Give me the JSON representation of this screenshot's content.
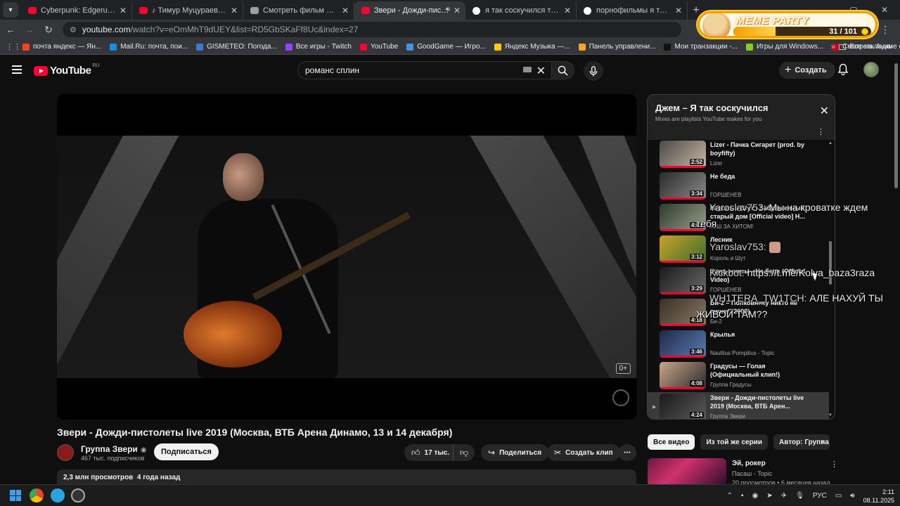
{
  "browser": {
    "tabs": [
      {
        "title": "Cyberpunk: Edgerunners | \"I Re",
        "icon": "youtube-icon",
        "active": false
      },
      {
        "title": "♪ Тимур Муцураев - Погасли",
        "icon": "youtube-icon",
        "active": false
      },
      {
        "title": "Смотреть фильм Война онлай",
        "icon": "page-icon",
        "active": false
      },
      {
        "title": "Звери - Дожди-пистолеты",
        "icon": "youtube-icon",
        "active": true
      },
      {
        "title": "я так соскучился текст аккорд",
        "icon": "google-icon",
        "active": false
      },
      {
        "title": "порнофильмы я так соскучил",
        "icon": "google-icon",
        "active": false
      }
    ],
    "url_domain": "youtube.com",
    "url_path": "/watch?v=eOmMhT9dUEY&list=RD5GbSKaFf8Uc&index=27",
    "bookmarks": [
      {
        "label": "почта яндекс — Ян...",
        "color": "#fc3f1d"
      },
      {
        "label": "Mail.Ru: почта, пои...",
        "color": "#168de2"
      },
      {
        "label": "GISMETEO: Погода...",
        "color": "#3a7bd5"
      },
      {
        "label": "Все игры - Twitch",
        "color": "#9146ff"
      },
      {
        "label": "YouTube",
        "color": "#ff0033"
      },
      {
        "label": "GoodGame — Игро...",
        "color": "#4a90e2"
      },
      {
        "label": "Яндекс Музыка —...",
        "color": "#ffcc00"
      },
      {
        "label": "Панель управлени...",
        "color": "#f5a623"
      },
      {
        "label": "Мои транзакции -...",
        "color": "#111111"
      },
      {
        "label": "Игры для Windows...",
        "color": "#7ed321"
      },
      {
        "label": "Смотреть Аниме о...",
        "color": "#d0021b"
      }
    ],
    "all_bookmarks": "Все закладки"
  },
  "meme_party": {
    "title": "MEME PARTY",
    "count": "31 / 101",
    "progress": 0.307
  },
  "youtube": {
    "logo_text": "YouTube",
    "region": "RU",
    "search_value": "романс сплин",
    "create_label": "Создать"
  },
  "video": {
    "title": "Звери - Дожди-пистолеты live 2019 (Москва, ВТБ Арена Динамо, 13 и 14 декабря)",
    "age_rating": "0+",
    "channel_name": "Группа Звери",
    "subscribers": "467 тыс. подписчиков",
    "subscribe_label": "Подписаться",
    "likes": "17 тыс.",
    "share_label": "Поделиться",
    "clip_label": "Создать клип",
    "views": "2,3 млн просмотров",
    "age": "4 года назад"
  },
  "playlist": {
    "title": "Джем – Я так соскучился",
    "subtitle": "Mixes are playlists YouTube makes for you",
    "items": [
      {
        "title": "Lizer - Пачка Сигарет (prod. by boyfifty)",
        "artist": "Lizer",
        "duration": "2:52",
        "colors": [
          "#4a4a4a",
          "#c8b8a0"
        ],
        "current": false
      },
      {
        "title": "Не беда",
        "artist": "ГОРШЕНЕВ",
        "duration": "3:34",
        "colors": [
          "#2a2a2a",
          "#8a8a8a"
        ],
        "current": false
      },
      {
        "title": "Король и Шут - Заброшенный старый дом [Official video] Н...",
        "artist": "КиШ ЗА ХИТОМ!",
        "duration": "4:03",
        "colors": [
          "#2e3b2e",
          "#9aa08a"
        ],
        "current": false
      },
      {
        "title": "Лесник",
        "artist": "Король и Шут",
        "duration": "3:12",
        "colors": [
          "#c9a12a",
          "#3a6e2a"
        ],
        "current": false
      },
      {
        "title": "Кукрыниксы - Не беда (Official Video)",
        "artist": "ГОРШЕНЕВ",
        "duration": "3:29",
        "colors": [
          "#1a1a1a",
          "#6a6a6a"
        ],
        "current": false
      },
      {
        "title": "Би-2 – Полковнику никто не пишет (2000)",
        "artist": "Би-2",
        "duration": "4:18",
        "colors": [
          "#3a3026",
          "#8a7a66"
        ],
        "current": false
      },
      {
        "title": "Крылья",
        "artist": "Nautilus Pompilius - Topic",
        "duration": "3:46",
        "colors": [
          "#1f2a4a",
          "#5a7ab0"
        ],
        "current": false
      },
      {
        "title": "Градусы — Голая (Официальный клип!)",
        "artist": "Группа Градусы",
        "duration": "4:08",
        "colors": [
          "#c9a58a",
          "#2a2a2a"
        ],
        "current": false
      },
      {
        "title": "Звери - Дожди-пистолеты live 2019 (Москва, ВТБ Арен...",
        "artist": "Группа Звери",
        "duration": "4:24",
        "colors": [
          "#1a1a1a",
          "#5a5a5a"
        ],
        "current": true
      }
    ]
  },
  "chat": [
    {
      "user": "Yaroslav753:",
      "text": "Мы на кроватке ждем",
      "cont": "тебя"
    },
    {
      "user": "Yaroslav753:",
      "text": ""
    },
    {
      "user": "Kickbot:",
      "text": "https://t.me/Kolya_baza3raza"
    },
    {
      "user": "WH1TERA_TW1TCH:",
      "text": "АЛЕ НАХУЙ ТЫ",
      "cont": "ЖИВОЙ ТАМ??"
    }
  ],
  "chips": [
    "Все видео",
    "Из той же серии",
    "Автор: Группа"
  ],
  "recommendation": {
    "title": "Эй, рокер",
    "channel": "Пасаш - Topic",
    "meta": "20 просмотров • 6 месяцев назад"
  },
  "taskbar": {
    "lang": "РУС",
    "time": "2:11",
    "date": "08.11.2025"
  }
}
